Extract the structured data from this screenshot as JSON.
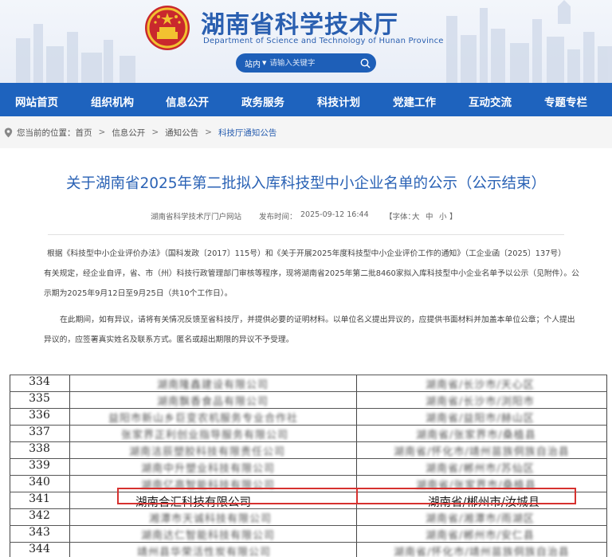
{
  "header": {
    "title": "湖南省科学技术厅",
    "subtitle": "Department of Science and Technology of Hunan Province",
    "search": {
      "scope": "站内",
      "placeholder": "请输入关键字"
    }
  },
  "nav": {
    "items": [
      "网站首页",
      "组织机构",
      "信息公开",
      "政务服务",
      "科技计划",
      "党建工作",
      "互动交流",
      "专题专栏"
    ]
  },
  "breadcrumb": {
    "prefix": "您当前的位置：",
    "items": [
      "首页",
      "信息公开",
      "通知公告",
      "科技厅通知公告"
    ],
    "separator": ">"
  },
  "article": {
    "title": "关于湖南省2025年第二批拟入库科技型中小企业名单的公示（公示结束）",
    "source": "湖南省科学技术厅门户网站",
    "publish_label": "发布时间：",
    "publish_time": "2025-09-12 16:44",
    "font_label": "【字体：",
    "font_large": "大",
    "font_medium": "中",
    "font_small": "小",
    "font_close": "】",
    "paragraph1": [
      "根据《科技型中小企业评价办法》（国科发政〔2017〕115号）和《关于开展2025年度科技型中小企业评价工作的通知》（工企业函〔2025〕137号）",
      "有关规定，经企业自评，省、市（州）科技行政管理部门审核等程序，现将湖南省2025年第二批8460家拟入库科技型中小企业名单予以公示（见附件）。公",
      "示期为2025年9月12日至9月25日（共10个工作日）。"
    ],
    "paragraph2": [
      "在此期间，如有异议，请将有关情况反馈至省科技厅，并提供必要的证明材料。以单位名义提出异议的，应提供书面材料并加盖本单位公章；个人提出",
      "异议的，应签署真实姓名及联系方式。匿名或超出期限的异议不予受理。"
    ]
  },
  "table": {
    "rows": [
      {
        "num": "334",
        "name": "湖南隆鑫建设有限公司",
        "addr": "湖南省/长沙市/天心区"
      },
      {
        "num": "335",
        "name": "湖南飘香食品有限公司",
        "addr": "湖南省/长沙市/浏阳市"
      },
      {
        "num": "336",
        "name": "益阳市新山乡巨变农机服务专业合作社",
        "addr": "湖南省/益阳市/赫山区"
      },
      {
        "num": "337",
        "name": "张家界正利创业指导服务有限公司",
        "addr": "湖南省/张家界市/桑植县"
      },
      {
        "num": "338",
        "name": "湖南洁辰塑胶科技有限责任公司",
        "addr": "湖南省/怀化市/靖州苗族侗族自治县"
      },
      {
        "num": "339",
        "name": "湖南中升塑业科技有限公司",
        "addr": "湖南省/郴州市/苏仙区"
      },
      {
        "num": "340",
        "name": "湖南亿高智能科技有限公司",
        "addr": "湖南省/张家界市/桑植县"
      },
      {
        "num": "341",
        "name": "湖南合汇科技有限公司",
        "addr": "湖南省/郴州市/汝城县"
      },
      {
        "num": "342",
        "name": "湘潭市天诚科技有限公司",
        "addr": "湖南省/湘潭市/雨湖区"
      },
      {
        "num": "343",
        "name": "湖南达仁智能科技有限公司",
        "addr": "湖南省/郴州市/安仁县"
      },
      {
        "num": "344",
        "name": "靖州县华荣活性炭有限公司",
        "addr": "湖南省/怀化市/靖州苗族侗族自治县"
      }
    ],
    "highlighted_num": "341",
    "highlight_color": "#d6312f"
  },
  "colors": {
    "nav_bg": "#1e63be",
    "title_blue": "#2a62b5"
  }
}
